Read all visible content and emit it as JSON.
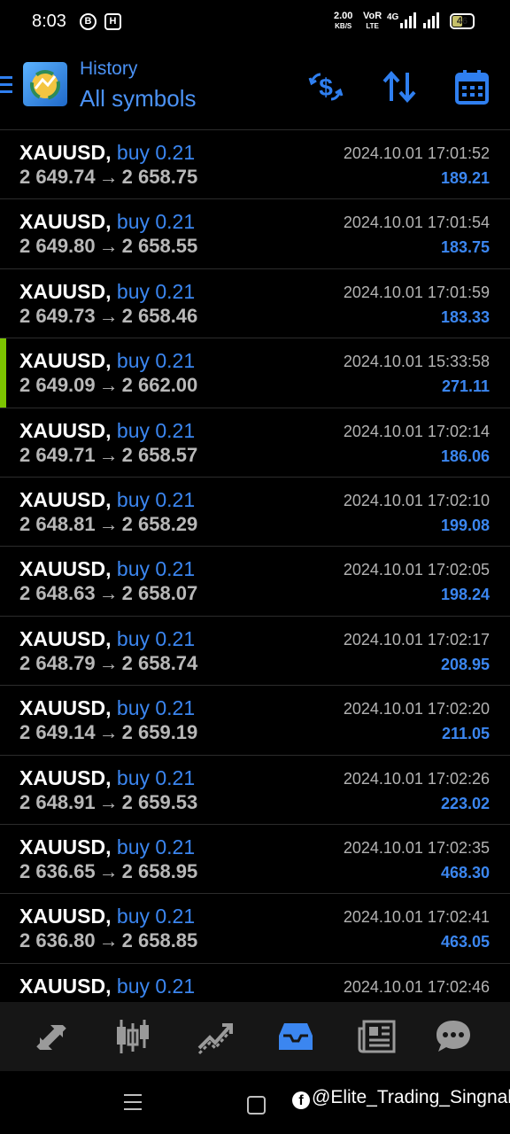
{
  "status_bar": {
    "time": "8:03",
    "icon_b": "B",
    "icon_h": "H",
    "net_speed_value": "2.00",
    "net_speed_unit": "KB/S",
    "volte_top": "VoR",
    "volte_bottom": "LTE",
    "network": "4G",
    "battery": "46"
  },
  "header": {
    "subtitle": "History",
    "title": "All symbols"
  },
  "trades": [
    {
      "symbol": "XAUUSD,",
      "side": "buy 0.21",
      "open": "2 649.74",
      "close": "2 658.75",
      "time": "2024.10.01 17:01:52",
      "profit": "189.21",
      "marked": false
    },
    {
      "symbol": "XAUUSD,",
      "side": "buy 0.21",
      "open": "2 649.80",
      "close": "2 658.55",
      "time": "2024.10.01 17:01:54",
      "profit": "183.75",
      "marked": false
    },
    {
      "symbol": "XAUUSD,",
      "side": "buy 0.21",
      "open": "2 649.73",
      "close": "2 658.46",
      "time": "2024.10.01 17:01:59",
      "profit": "183.33",
      "marked": false
    },
    {
      "symbol": "XAUUSD,",
      "side": "buy 0.21",
      "open": "2 649.09",
      "close": "2 662.00",
      "time": "2024.10.01 15:33:58",
      "profit": "271.11",
      "marked": true
    },
    {
      "symbol": "XAUUSD,",
      "side": "buy 0.21",
      "open": "2 649.71",
      "close": "2 658.57",
      "time": "2024.10.01 17:02:14",
      "profit": "186.06",
      "marked": false
    },
    {
      "symbol": "XAUUSD,",
      "side": "buy 0.21",
      "open": "2 648.81",
      "close": "2 658.29",
      "time": "2024.10.01 17:02:10",
      "profit": "199.08",
      "marked": false
    },
    {
      "symbol": "XAUUSD,",
      "side": "buy 0.21",
      "open": "2 648.63",
      "close": "2 658.07",
      "time": "2024.10.01 17:02:05",
      "profit": "198.24",
      "marked": false
    },
    {
      "symbol": "XAUUSD,",
      "side": "buy 0.21",
      "open": "2 648.79",
      "close": "2 658.74",
      "time": "2024.10.01 17:02:17",
      "profit": "208.95",
      "marked": false
    },
    {
      "symbol": "XAUUSD,",
      "side": "buy 0.21",
      "open": "2 649.14",
      "close": "2 659.19",
      "time": "2024.10.01 17:02:20",
      "profit": "211.05",
      "marked": false
    },
    {
      "symbol": "XAUUSD,",
      "side": "buy 0.21",
      "open": "2 648.91",
      "close": "2 659.53",
      "time": "2024.10.01 17:02:26",
      "profit": "223.02",
      "marked": false
    },
    {
      "symbol": "XAUUSD,",
      "side": "buy 0.21",
      "open": "2 636.65",
      "close": "2 658.95",
      "time": "2024.10.01 17:02:35",
      "profit": "468.30",
      "marked": false
    },
    {
      "symbol": "XAUUSD,",
      "side": "buy 0.21",
      "open": "2 636.80",
      "close": "2 658.85",
      "time": "2024.10.01 17:02:41",
      "profit": "463.05",
      "marked": false
    },
    {
      "symbol": "XAUUSD,",
      "side": "buy 0.21",
      "open": "",
      "close": "",
      "time": "2024.10.01 17:02:46",
      "profit": "",
      "marked": false
    }
  ],
  "tabs": [
    {
      "name": "quotes",
      "icon": "quotes-arrows-icon",
      "active": false
    },
    {
      "name": "chart",
      "icon": "candlestick-icon",
      "active": false
    },
    {
      "name": "trade",
      "icon": "trade-line-icon",
      "active": false
    },
    {
      "name": "history",
      "icon": "inbox-tray-icon",
      "active": true
    },
    {
      "name": "news",
      "icon": "newspaper-icon",
      "active": false
    },
    {
      "name": "messages",
      "icon": "chat-bubble-icon",
      "active": false
    }
  ],
  "colors": {
    "accent": "#3b86f0",
    "marker": "#7cc400",
    "price": "#b8b8b8",
    "tab_inactive": "#9a9a9a"
  },
  "watermark": "@Elite_Trading_Singnal"
}
